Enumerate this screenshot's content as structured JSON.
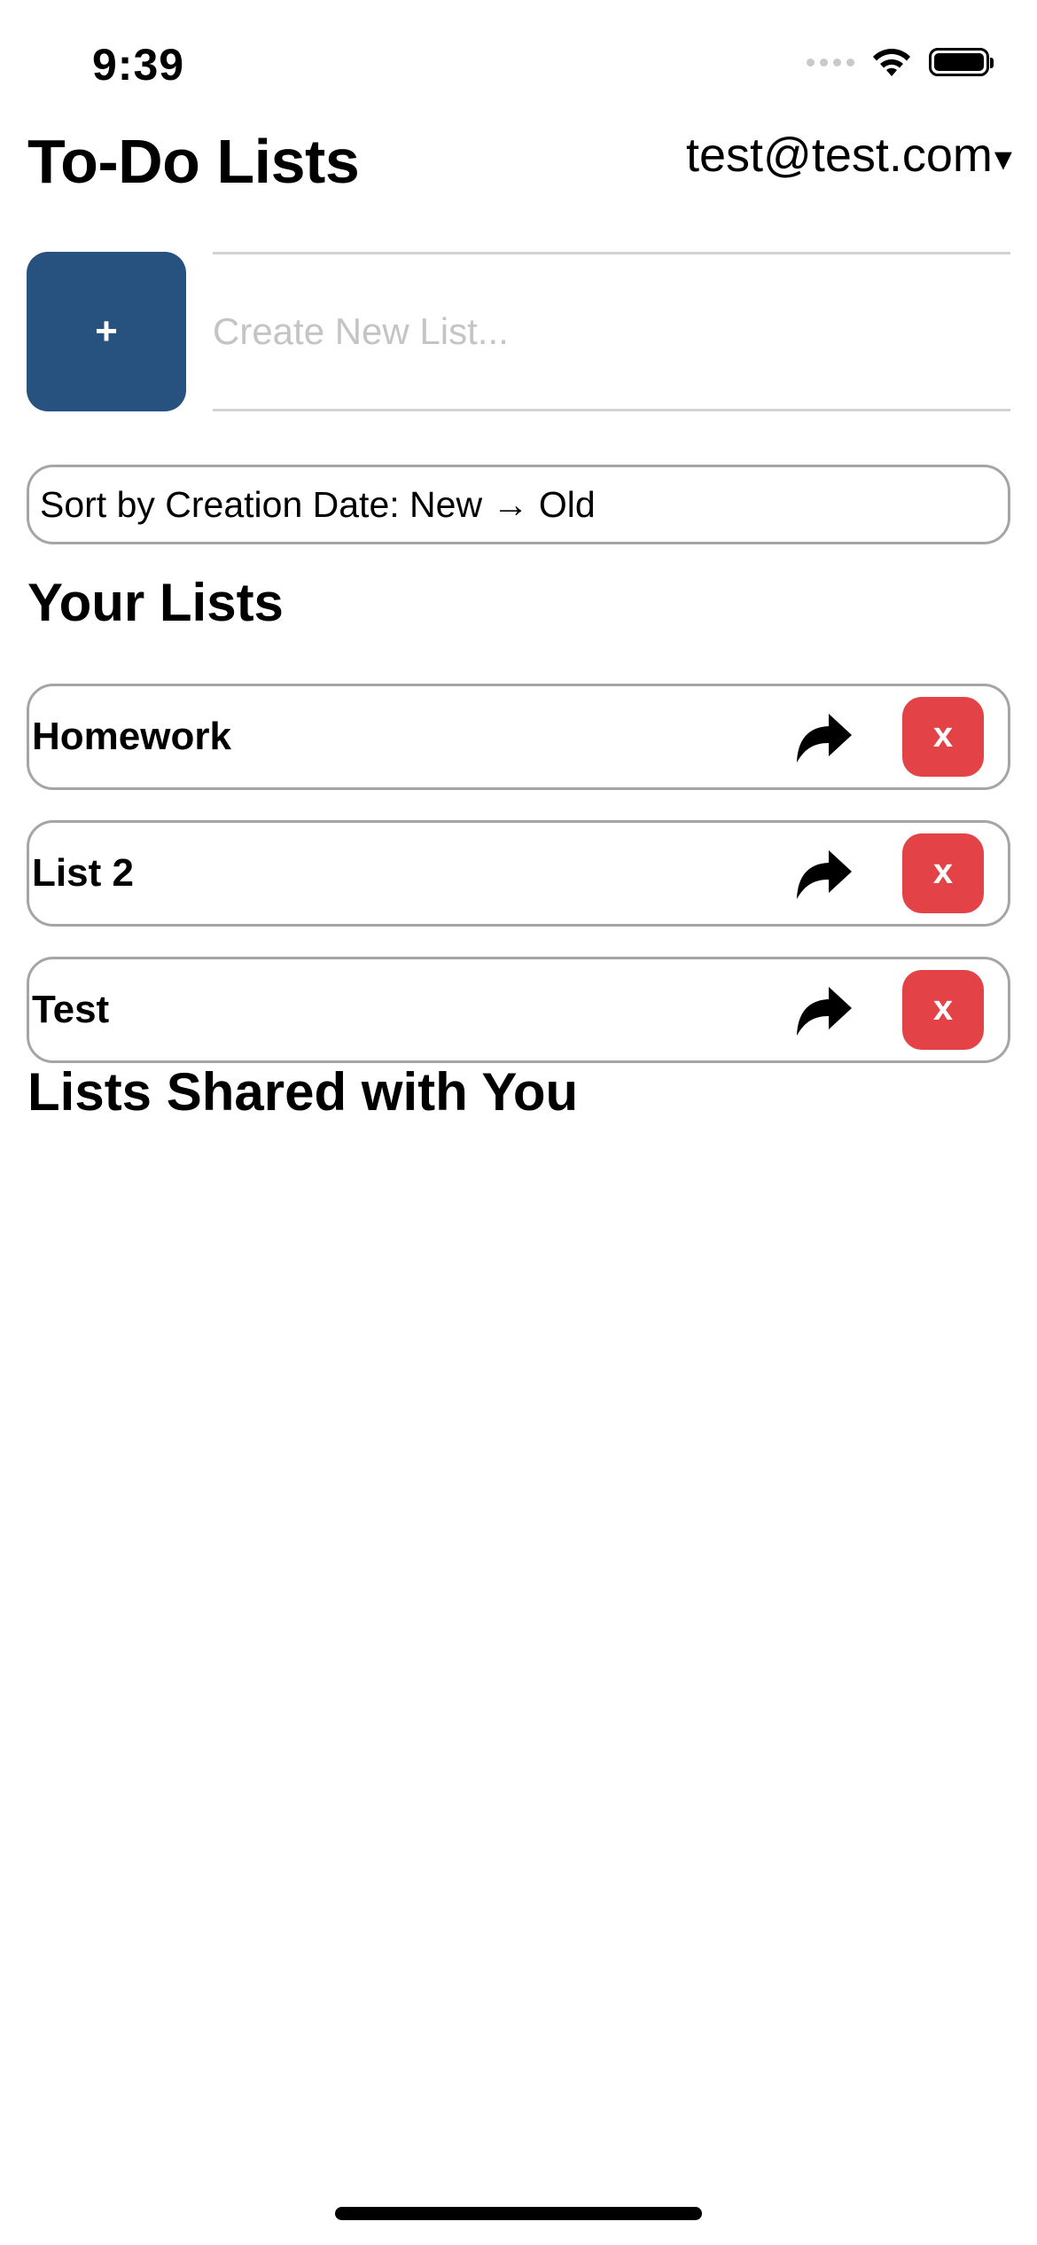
{
  "status_bar": {
    "time": "9:39",
    "icons": [
      "signal-icon",
      "wifi-icon",
      "battery-icon"
    ]
  },
  "header": {
    "title": "To-Do Lists",
    "user_email": "test@test.com",
    "menu_caret": "▾"
  },
  "new_list": {
    "add_label": "+",
    "placeholder": "Create New List...",
    "value": ""
  },
  "sort": {
    "label": "Sort by Creation Date: New → Old"
  },
  "your_lists": {
    "heading": "Your Lists",
    "items": [
      {
        "name": "Homework",
        "delete_label": "x"
      },
      {
        "name": "List 2",
        "delete_label": "x"
      },
      {
        "name": "Test",
        "delete_label": "x"
      }
    ]
  },
  "shared_lists": {
    "heading": "Lists Shared with You",
    "items": []
  },
  "colors": {
    "add_button": "#27527f",
    "delete_button": "#e34246",
    "border": "#a5a5a5"
  }
}
